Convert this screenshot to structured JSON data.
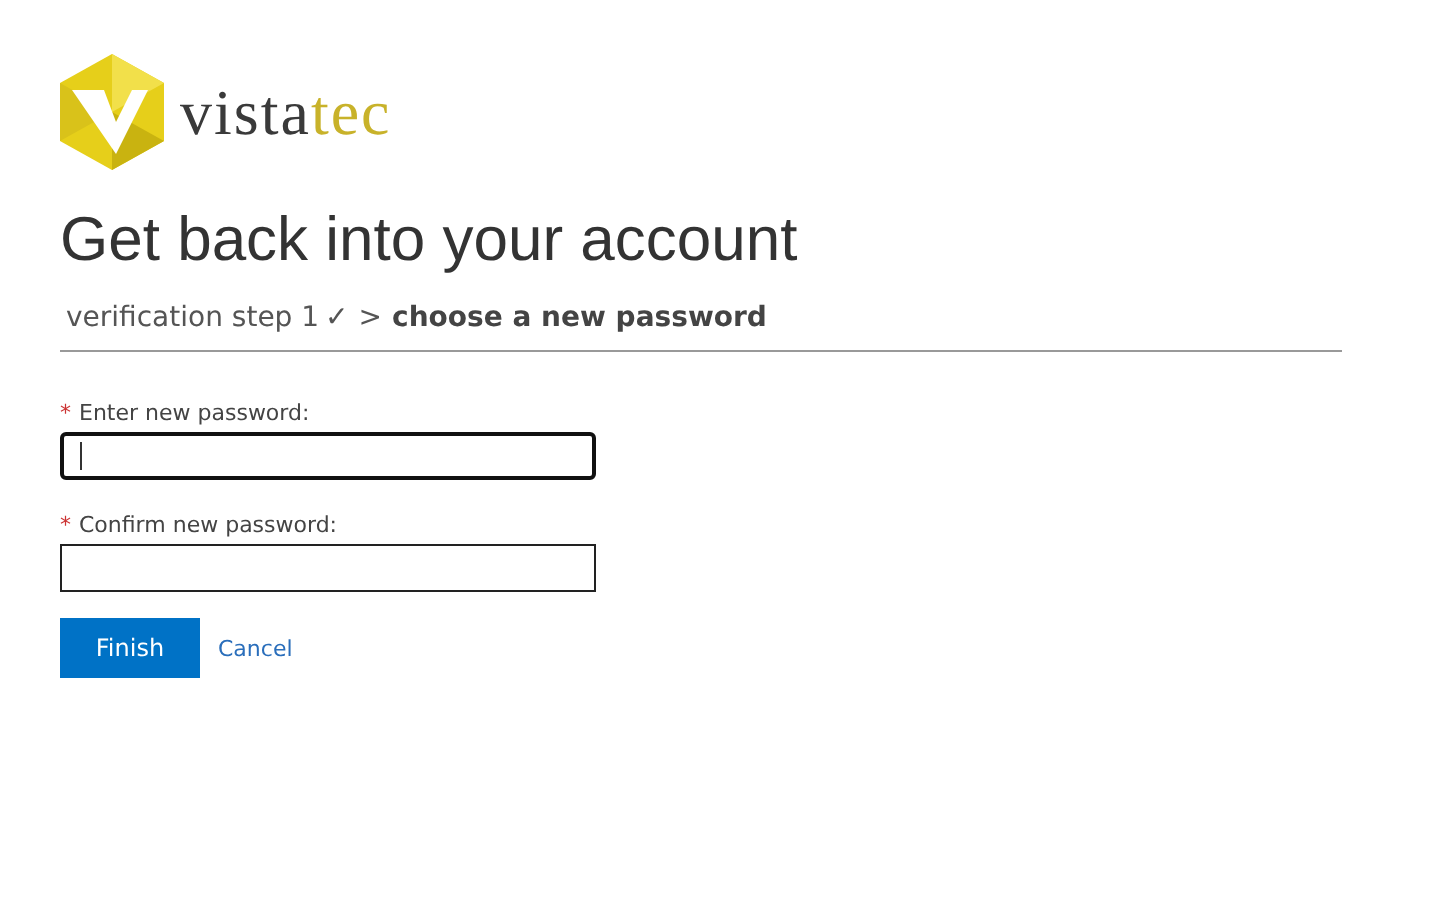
{
  "logo": {
    "wordmark_main": "vista",
    "wordmark_accent": "tec"
  },
  "heading": "Get back into your account",
  "breadcrumb": {
    "steps": [
      {
        "label": "verification step 1",
        "mark": "✓",
        "selected": false
      },
      {
        "label": "choose a new password",
        "selected": true
      }
    ],
    "separator": ">"
  },
  "fields": [
    {
      "required_mark": "*",
      "label": "Enter new password:",
      "focused": true
    },
    {
      "required_mark": "*",
      "label": "Confirm new password:",
      "focused": false
    }
  ],
  "buttons": {
    "primary": "Finish",
    "link": "Cancel"
  }
}
